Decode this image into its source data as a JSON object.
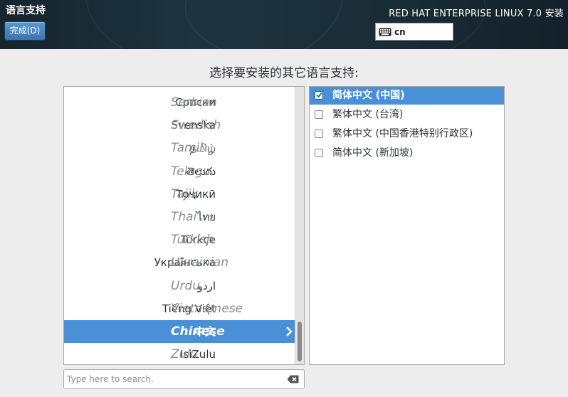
{
  "header": {
    "spoke_title": "语言支持",
    "done_button": "完成(D)",
    "product_title": "RED HAT ENTERPRISE LINUX 7.0 安装",
    "keyboard_layout": "cn"
  },
  "prompt": "选择要安装的其它语言支持:",
  "languages": [
    {
      "native": "Српски",
      "english": "Serbian"
    },
    {
      "native": "Svenska",
      "english": "Swedish"
    },
    {
      "native": "தமிழ்",
      "english": "Tamil"
    },
    {
      "native": "తెలుగు",
      "english": "Telugu"
    },
    {
      "native": "Тоҷикӣ",
      "english": "Tajik"
    },
    {
      "native": "ไทย",
      "english": "Thai"
    },
    {
      "native": "Türkçe",
      "english": "Turkish"
    },
    {
      "native": "Українська",
      "english": "Ukrainian"
    },
    {
      "native": "اردو",
      "english": "Urdu"
    },
    {
      "native": "Tiếng Việt",
      "english": "Vietnamese"
    },
    {
      "native": "中文",
      "english": "Chinese",
      "selected": true
    },
    {
      "native": "IsiZulu",
      "english": "Zulu"
    }
  ],
  "search": {
    "placeholder": "Type here to search.",
    "value": ""
  },
  "locales": [
    {
      "label": "简体中文 (中国)",
      "checked": true,
      "selected": true
    },
    {
      "label": "繁体中文 (台湾)",
      "checked": false
    },
    {
      "label": "繁体中文 (中国香港特别行政区)",
      "checked": false
    },
    {
      "label": "简体中文 (新加坡)",
      "checked": false
    }
  ],
  "colors": {
    "selection": "#4a90d9",
    "header_bg": "#1d3440"
  }
}
